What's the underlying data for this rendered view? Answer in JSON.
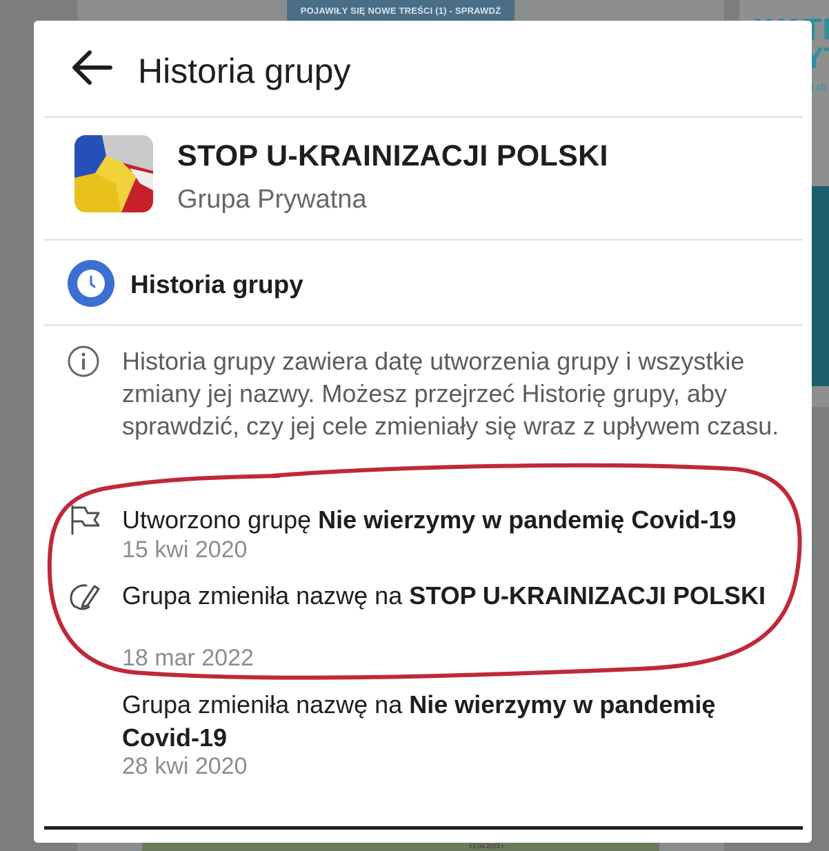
{
  "background": {
    "notice_banner": "POJAWIŁY SIĘ NOWE TREŚCI (1) - SPRAWDŹ",
    "thumb_date": "13.04.2023 r."
  },
  "header": {
    "back_icon": "arrow-left-icon",
    "title": "Historia grupy"
  },
  "group": {
    "name": "STOP U-KRAINIZACJI POLSKI",
    "type": "Grupa Prywatna"
  },
  "history_section": {
    "icon": "clock-icon",
    "heading": "Historia grupy"
  },
  "info": {
    "icon": "info-icon",
    "text": "Historia grupy zawiera datę utworzenia grupy i wszystkie zmiany jej nazwy. Możesz przejrzeć Historię grupy, aby sprawdzić, czy jej cele zmieniały się wraz z upływem czasu."
  },
  "entries": [
    {
      "icon": "flag-icon",
      "prefix": "Utworzono grupę ",
      "name": "Nie wierzymy w pandemię Covid-19",
      "date": "15 kwi 2020"
    },
    {
      "icon": "edit-icon",
      "prefix": "Grupa zmieniła nazwę na ",
      "name": "STOP U-KRAINIZACJI POLSKI",
      "date": "18 mar 2022"
    },
    {
      "icon": "",
      "prefix": "Grupa zmieniła nazwę na ",
      "name": "Nie wierzymy w pandemię Covid-19",
      "date": "28 kwi 2020"
    }
  ],
  "colors": {
    "highlight_circle": "#c0283a",
    "clock_blue": "#3b6fd4",
    "notice_bar": "#4a6e86"
  }
}
